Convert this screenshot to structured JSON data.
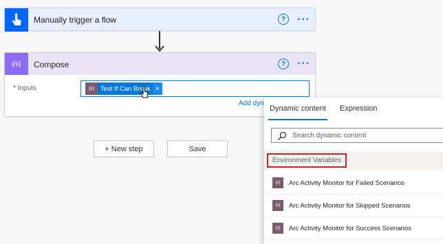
{
  "trigger": {
    "title": "Manually trigger a flow",
    "help_glyph": "?",
    "more_glyph": "···",
    "icon": "hand-tap-icon"
  },
  "compose": {
    "title": "Compose",
    "help_glyph": "?",
    "more_glyph": "···",
    "icon_glyph": "{⁄x}",
    "inputs_required_mark": "*",
    "inputs_label": "Inputs",
    "token": {
      "icon_glyph": "{x}",
      "text": "Test If Can Break",
      "remove_glyph": "×"
    },
    "add_dynamic_link": "Add dyn"
  },
  "actions": {
    "new_step_label": "+ New step",
    "save_label": "Save"
  },
  "flyout": {
    "tabs": [
      {
        "label": "Dynamic content",
        "selected": true
      },
      {
        "label": "Expression",
        "selected": false
      }
    ],
    "search_placeholder": "Search dynamic content",
    "section_label": "Environment Variables",
    "items": [
      {
        "label": "Arc Activity Monitor for Failed Scenarios",
        "icon_glyph": "{x}"
      },
      {
        "label": "Arc Activity Monitor for Skipped Scenarios",
        "icon_glyph": "{x}"
      },
      {
        "label": "Arc Activity Monitor for Success Scenarios",
        "icon_glyph": "{x}"
      }
    ]
  },
  "colors": {
    "accent": "#0078d4",
    "trigger_icon_bg": "#0066ff",
    "compose_icon_bg": "#8c6cf2",
    "variable_icon_bg": "#7a5c6e",
    "highlight_border": "#c4262e"
  }
}
